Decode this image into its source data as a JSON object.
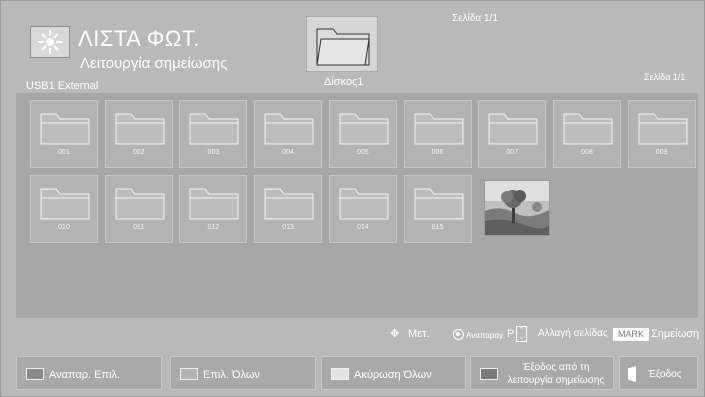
{
  "header": {
    "title": "ΛΙΣΤΑ ΦΩΤ.",
    "subtitle": "Λειτουργία σημείωσης",
    "device": "USB1 External",
    "page_indicator_top": "Σελίδα 1/1",
    "page_indicator_right": "Σελίδα 1/1",
    "current_folder": "Δίσκος1"
  },
  "grid": {
    "folders": [
      "001",
      "002",
      "003",
      "004",
      "005",
      "006",
      "007",
      "008",
      "009",
      "010",
      "011",
      "012",
      "013",
      "014",
      "015"
    ]
  },
  "legend": {
    "move_icon": "move-arrows-icon",
    "move_label": "Μετ.",
    "play_label": "Αναπαραγ.",
    "p_label": "P",
    "page_change_label": "Αλλαγή σελίδας",
    "mark_badge": "MARK",
    "mark_label": "Σημείωση"
  },
  "buttons": {
    "play_selected": "Αναπαρ. Επιλ.",
    "select_all": "Επιλ. Όλων",
    "unselect_all": "Ακύρωση Όλων",
    "exit_mark_mode": "Έξοδος από τη λειτουργία σημείωσης",
    "exit": "Έξοδος"
  },
  "colors": {
    "background": "#b9b9b9",
    "grid_panel": "#a7a7a7",
    "tile": "#b3b3b3",
    "swatch_red": "#8a8a8a",
    "swatch_green": "#b3b3b3",
    "swatch_yellow": "#e3e3e3",
    "swatch_blue": "#7a7a7a"
  }
}
